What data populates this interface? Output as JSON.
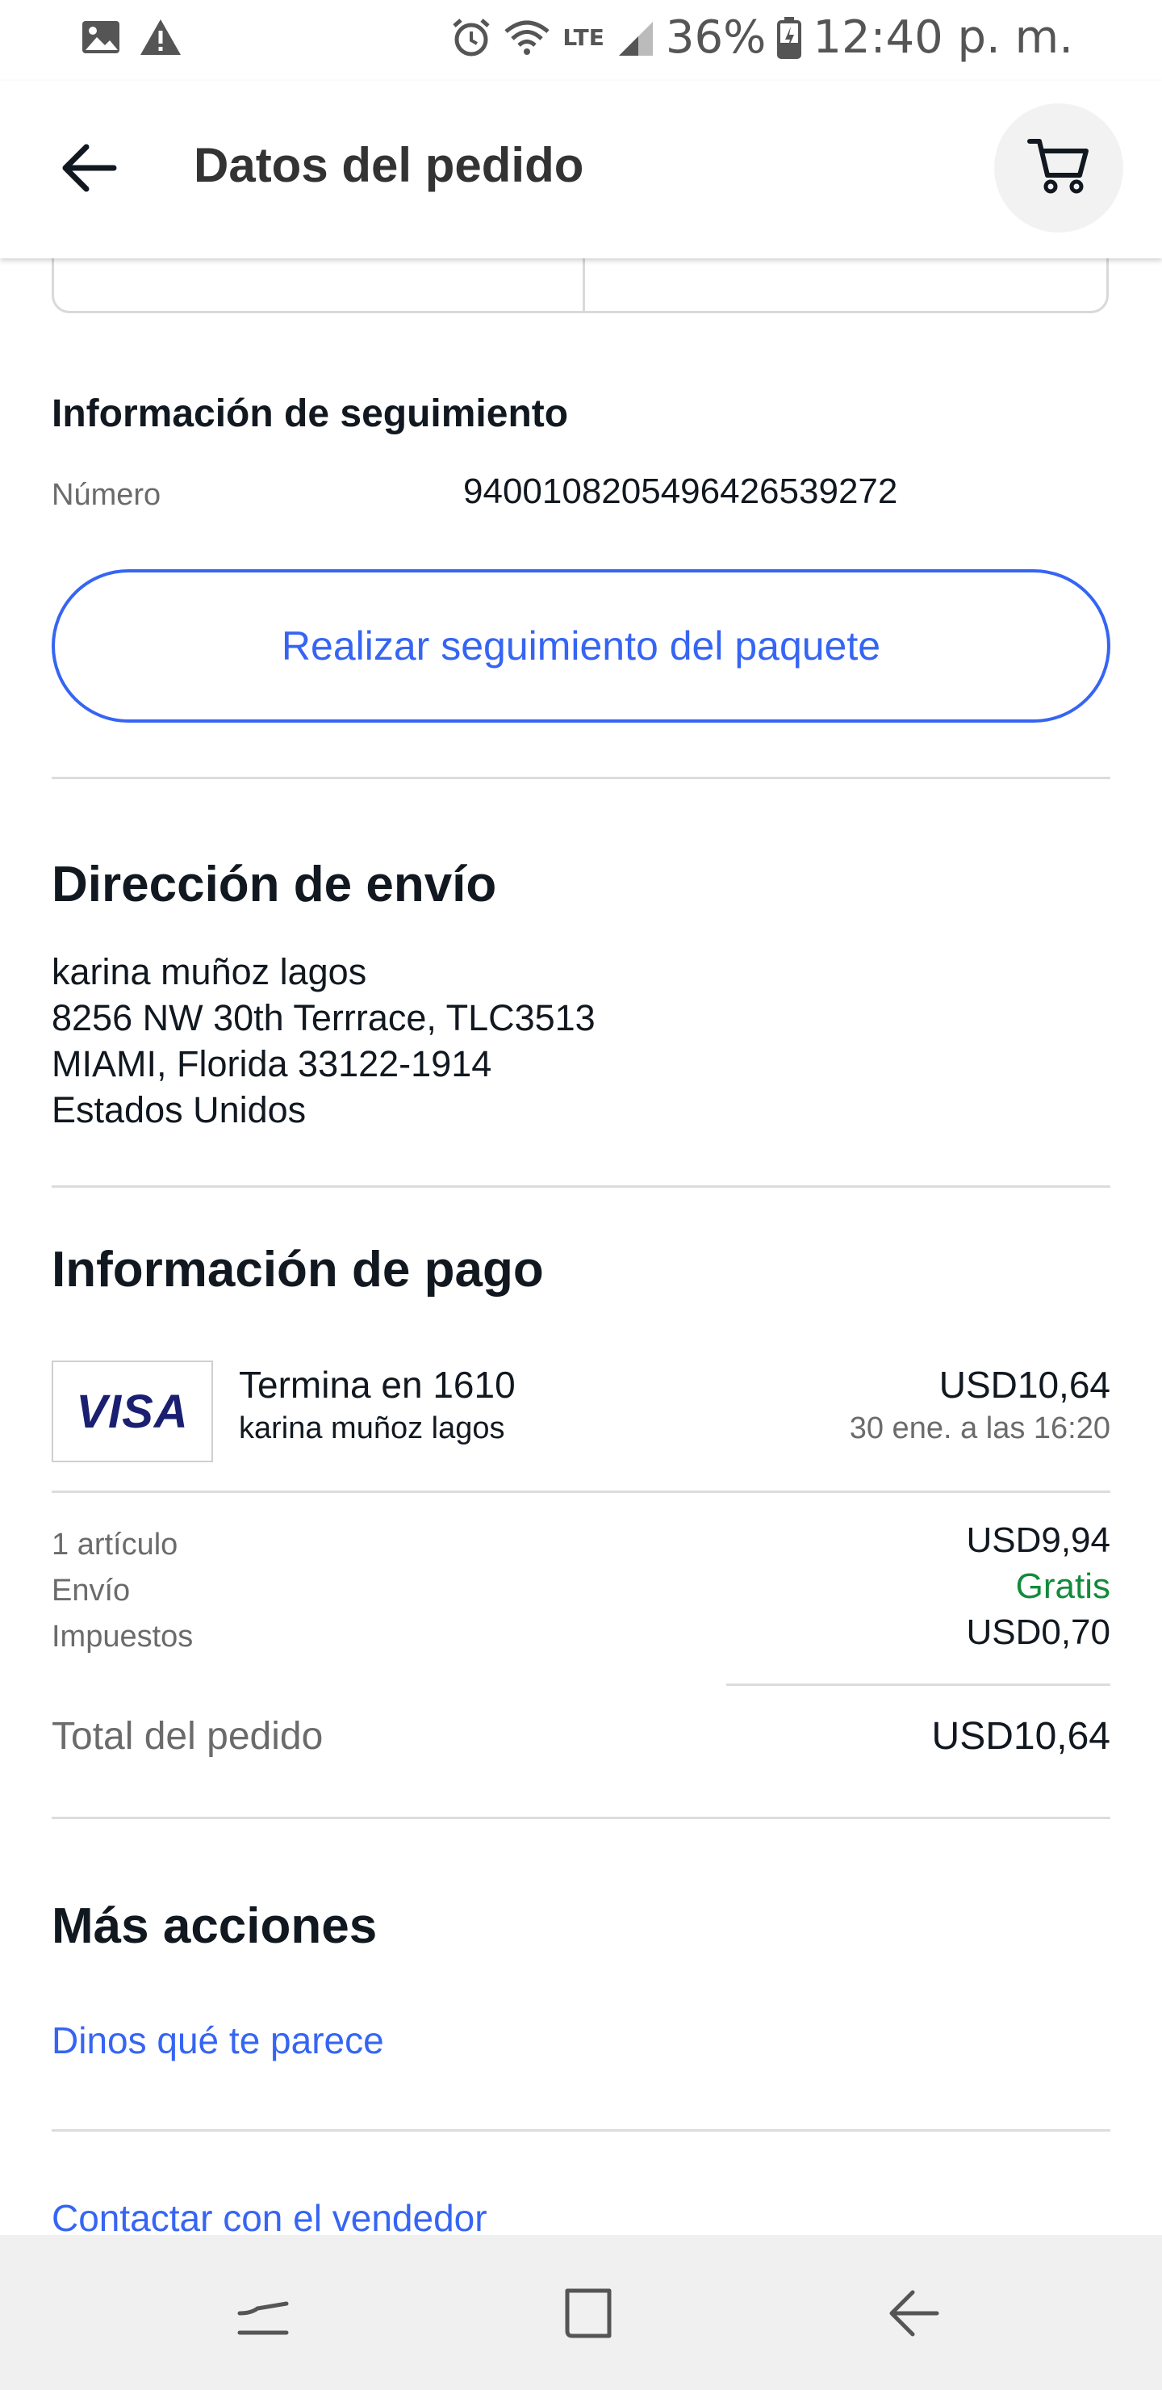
{
  "status_bar": {
    "battery": "36%",
    "time": "12:40 p. m.",
    "network": "LTE",
    "icons": [
      "image-icon",
      "warning-icon",
      "alarm-icon",
      "wifi-icon",
      "signal-icon",
      "battery-icon"
    ]
  },
  "header": {
    "title": "Datos del pedido",
    "icons": [
      "back-arrow-icon",
      "cart-icon"
    ]
  },
  "tracking": {
    "heading": "Información de seguimiento",
    "number_label": "Número",
    "number_value": "9400108205496426539272",
    "button_label": "Realizar seguimiento del paquete"
  },
  "shipping": {
    "heading": "Dirección de envío",
    "lines": [
      "karina muñoz lagos",
      "8256 NW 30th Terrrace, TLC3513",
      "MIAMI, Florida 33122-1914",
      "Estados Unidos"
    ]
  },
  "payment": {
    "heading": "Información de pago",
    "card_brand": "VISA",
    "card_ending": "Termina en 1610",
    "card_holder": "karina muñoz lagos",
    "amount": "USD10,64",
    "date": "30 ene. a las 16:20",
    "items": [
      {
        "label": "1 artículo",
        "value": "USD9,94"
      },
      {
        "label": "Envío",
        "value": "Gratis"
      },
      {
        "label": "Impuestos",
        "value": "USD0,70"
      }
    ],
    "total_label": "Total del pedido",
    "total_value": "USD10,64",
    "colors": {
      "free_shipping": "#138a3b",
      "link": "#3665f3"
    }
  },
  "more_actions": {
    "heading": "Más acciones",
    "links": [
      "Dinos qué te parece",
      "Contactar con el vendedor"
    ]
  },
  "nav_bar": {
    "icons": [
      "recent-apps-icon",
      "home-icon",
      "back-icon"
    ]
  }
}
